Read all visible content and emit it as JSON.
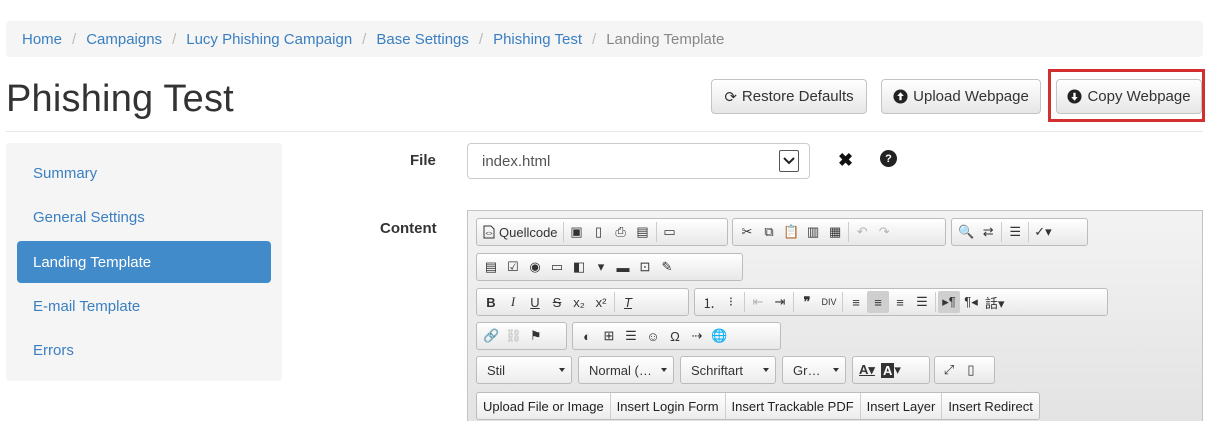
{
  "breadcrumb": {
    "items": [
      "Home",
      "Campaigns",
      "Lucy Phishing Campaign",
      "Base Settings",
      "Phishing Test"
    ],
    "current": "Landing Template",
    "separator": "/"
  },
  "page": {
    "title": "Phishing Test"
  },
  "actions": {
    "restore": "Restore Defaults",
    "upload": "Upload Webpage",
    "copy": "Copy Webpage"
  },
  "sidebar": {
    "items": [
      {
        "label": "Summary",
        "active": false
      },
      {
        "label": "General Settings",
        "active": false
      },
      {
        "label": "Landing Template",
        "active": true
      },
      {
        "label": "E-mail Template",
        "active": false
      },
      {
        "label": "Errors",
        "active": false
      }
    ]
  },
  "form": {
    "file_label": "File",
    "file_value": "index.html",
    "content_label": "Content"
  },
  "editor": {
    "source_label": "Quellcode",
    "dropdowns": {
      "style": "Stil",
      "format": "Normal (…",
      "font": "Schriftart",
      "size": "Gr…"
    },
    "insert_buttons": [
      "Upload File or Image",
      "Insert Login Form",
      "Insert Trackable PDF",
      "Insert Layer",
      "Insert Redirect"
    ]
  },
  "colors": {
    "link": "#3a7fc1",
    "active_nav": "#428bca",
    "highlight": "#d32f2f"
  }
}
